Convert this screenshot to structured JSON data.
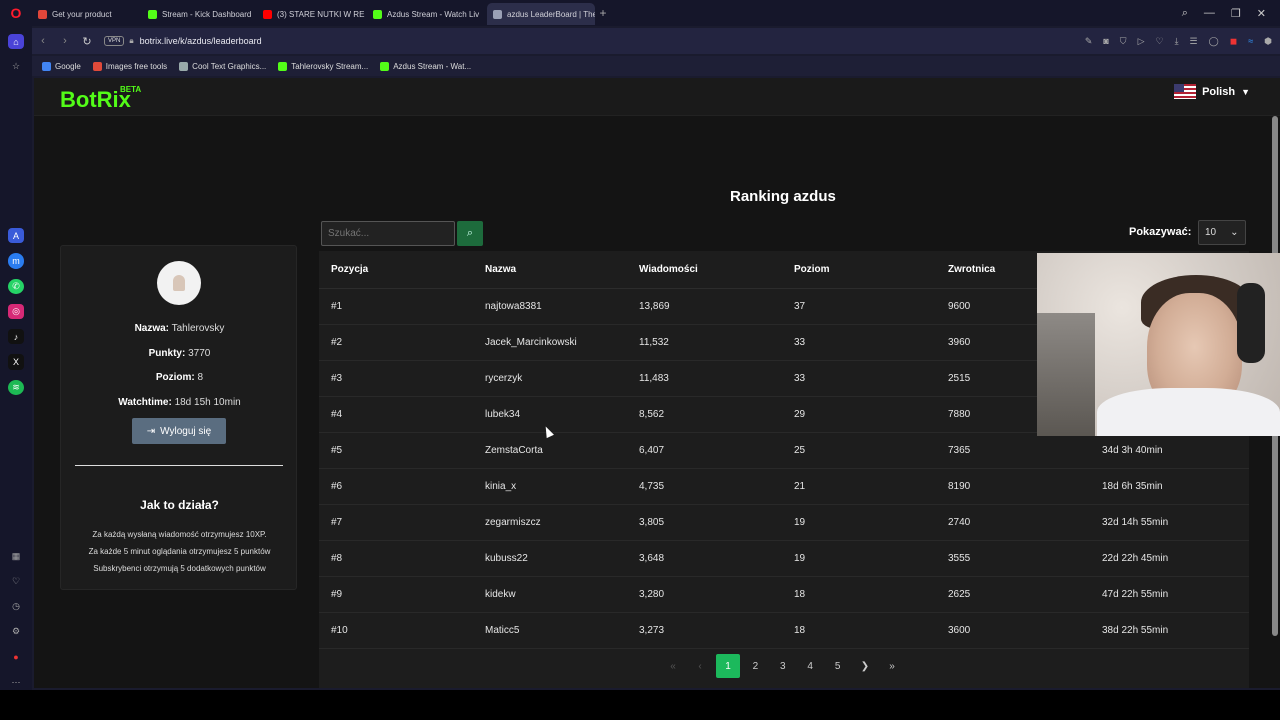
{
  "browser": {
    "tabs": [
      {
        "label": "Get your product",
        "color": "#e0463a"
      },
      {
        "label": "Stream - Kick Dashboard",
        "color": "#53fc18"
      },
      {
        "label": "(3) STARE NUTKI W RE",
        "color": "#ff0000"
      },
      {
        "label": "Azdus Stream - Watch Liv",
        "color": "#53fc18"
      },
      {
        "label": "azdus LeaderBoard | The",
        "color": "#9aa0b5"
      }
    ],
    "url": "botrix.live/k/azdus/leaderboard",
    "vpn": "VPN",
    "bookmarks": [
      {
        "label": "Google",
        "color": "#4285f4"
      },
      {
        "label": "Images free tools",
        "color": "#e04a3a"
      },
      {
        "label": "Cool Text Graphics...",
        "color": "#9aa"
      },
      {
        "label": "Tahlerovsky Stream...",
        "color": "#53fc18"
      },
      {
        "label": "Azdus Stream - Wat...",
        "color": "#53fc18"
      }
    ]
  },
  "site": {
    "logo": "BotRix",
    "beta": "BETA",
    "language": "Polish",
    "title": "Ranking azdus",
    "search_placeholder": "Szukać...",
    "show_label": "Pokazywać:",
    "show_value": "10"
  },
  "profile": {
    "name_label": "Nazwa:",
    "name": "Tahlerovsky",
    "points_label": "Punkty:",
    "points": "3770",
    "level_label": "Poziom:",
    "level": "8",
    "watch_label": "Watchtime:",
    "watch": "18d 15h 10min",
    "logout": "Wyloguj się",
    "how_title": "Jak to działa?",
    "rules": [
      "Za każdą wysłaną wiadomość otrzymujesz 10XP.",
      "Za każde 5 minut oglądania otrzymujesz 5 punktów",
      "Subskrybenci otrzymują 5 dodatkowych punktów"
    ]
  },
  "table": {
    "headers": [
      "Pozycja",
      "Nazwa",
      "Wiadomości",
      "Poziom",
      "Zwrotnica"
    ],
    "rows": [
      [
        "#1",
        "najtowa8381",
        "13,869",
        "37",
        "9600",
        ""
      ],
      [
        "#2",
        "Jacek_Marcinkowski",
        "11,532",
        "33",
        "3960",
        ""
      ],
      [
        "#3",
        "rycerzyk",
        "11,483",
        "33",
        "2515",
        ""
      ],
      [
        "#4",
        "lubek34",
        "8,562",
        "29",
        "7880",
        ""
      ],
      [
        "#5",
        "ZemstaCorta",
        "6,407",
        "25",
        "7365",
        "34d 3h 40min"
      ],
      [
        "#6",
        "kinia_x",
        "4,735",
        "21",
        "8190",
        "18d 6h 35min"
      ],
      [
        "#7",
        "zegarmiszcz",
        "3,805",
        "19",
        "2740",
        "32d 14h 55min"
      ],
      [
        "#8",
        "kubuss22",
        "3,648",
        "19",
        "3555",
        "22d 22h 45min"
      ],
      [
        "#9",
        "kidekw",
        "3,280",
        "18",
        "2625",
        "47d 22h 55min"
      ],
      [
        "#10",
        "Maticc5",
        "3,273",
        "18",
        "3600",
        "38d 22h 55min"
      ]
    ],
    "pages": [
      "1",
      "2",
      "3",
      "4",
      "5"
    ],
    "active_page": "1"
  },
  "colors": {
    "accent": "#53fc18",
    "active_page": "#1cb95c",
    "search_btn": "#1d6b3c"
  }
}
